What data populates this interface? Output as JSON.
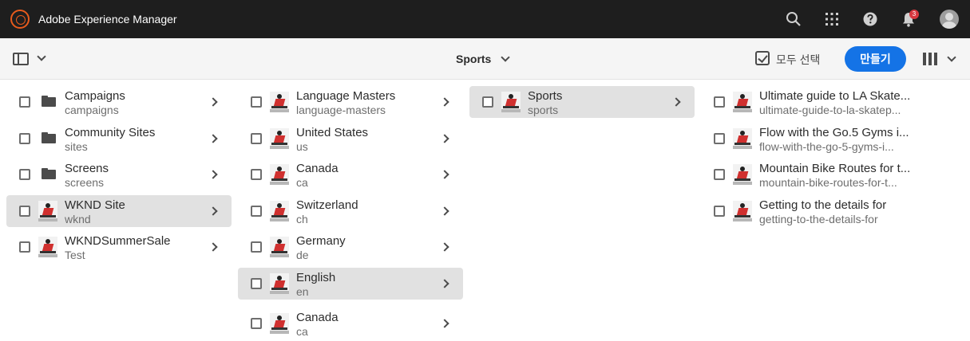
{
  "header": {
    "app_title": "Adobe Experience Manager",
    "logo_icon": "aem-logo-icon",
    "icons": [
      "search-icon",
      "apps-grid-icon",
      "help-icon",
      "bell-icon"
    ],
    "notification_count": "3",
    "accent_color": "#e85b1c"
  },
  "actionbar": {
    "current_location": "Sports",
    "select_all_label": "모두 선택",
    "create_label": "만들기",
    "create_color": "#1473e6"
  },
  "columns": [
    {
      "items": [
        {
          "title": "Campaigns",
          "name": "campaigns",
          "icon": "folder-icon",
          "selected": false
        },
        {
          "title": "Community Sites",
          "name": "sites",
          "icon": "folder-icon",
          "selected": false
        },
        {
          "title": "Screens",
          "name": "screens",
          "icon": "folder-icon",
          "selected": false
        },
        {
          "title": "WKND Site",
          "name": "wknd",
          "icon": "thumbnail",
          "selected": true
        },
        {
          "title": "WKNDSummerSale",
          "name": "Test",
          "icon": "thumbnail",
          "selected": false
        }
      ]
    },
    {
      "items": [
        {
          "title": "Language Masters",
          "name": "language-masters",
          "selected": false
        },
        {
          "title": "United States",
          "name": "us",
          "selected": false
        },
        {
          "title": "Canada",
          "name": "ca",
          "selected": false
        },
        {
          "title": "Switzerland",
          "name": "ch",
          "selected": false
        },
        {
          "title": "Germany",
          "name": "de",
          "selected": false
        },
        {
          "title": "English",
          "name": "en",
          "selected": true
        },
        {
          "title": "Canada",
          "name": "ca",
          "selected": false
        }
      ]
    },
    {
      "items": [
        {
          "title": "Sports",
          "name": "sports",
          "selected": true
        }
      ]
    },
    {
      "items": [
        {
          "title": "Ultimate guide to LA Skate...",
          "name": "ultimate-guide-to-la-skatep..."
        },
        {
          "title": "Flow with the Go.5 Gyms i...",
          "name": "flow-with-the-go-5-gyms-i..."
        },
        {
          "title": "Mountain Bike Routes for t...",
          "name": "mountain-bike-routes-for-t..."
        },
        {
          "title": "Getting to the details for",
          "name": "getting-to-the-details-for"
        }
      ]
    }
  ]
}
